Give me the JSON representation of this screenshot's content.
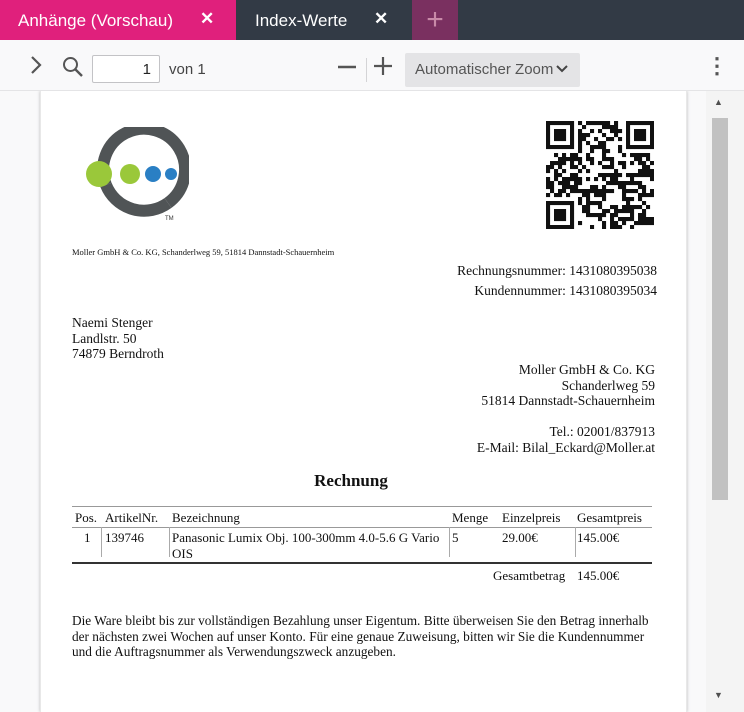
{
  "tabs": [
    {
      "label": "Anhänge (Vorschau)",
      "close": "✕"
    },
    {
      "label": "Index-Werte",
      "close": "✕"
    }
  ],
  "tab_add": "+",
  "toolbar": {
    "page_value": "1",
    "of_pages": "von 1",
    "zoom_minus": "—",
    "zoom_plus": "+",
    "zoom_label": "Automatischer Zoom",
    "menu_icon": "⋮"
  },
  "document": {
    "sender_line": "Moller GmbH & Co. KG, Schanderlweg 59, 51814 Dannstadt-Schauernheim",
    "invoice_number": "Rechnungsnummer: 1431080395038",
    "customer_number": "Kundennummer: 1431080395034",
    "recipient": [
      "Naemi Stenger",
      "Landlstr. 50",
      "74879 Berndroth"
    ],
    "company": [
      "Moller GmbH & Co. KG",
      "Schanderlweg 59",
      "51814 Dannstadt-Schauernheim"
    ],
    "contact": [
      "Tel.: 02001/837913",
      "E-Mail: Bilal_Eckard@Moller.at"
    ],
    "title": "Rechnung",
    "table": {
      "headers": [
        "Pos.",
        "ArtikelNr.",
        "Bezeichnung",
        "Menge",
        "Einzelpreis",
        "Gesamtpreis"
      ],
      "rows": [
        [
          "1",
          "139746",
          "Panasonic Lumix Obj. 100-300mm 4.0-5.6 G Vario OIS",
          "5",
          "29.00€",
          "145.00€"
        ]
      ],
      "total_label": "Gesamtbetrag",
      "total_value": "145.00€"
    },
    "footer": "Die Ware bleibt bis zur vollständigen Bezahlung unser Eigentum. Bitte überweisen Sie den Betrag innerhalb der nächsten zwei Wochen auf unser Konto. Für eine genaue Zuweisung, bitten wir Sie die Kundennummer und die Auftragsnummer als Verwendungszweck anzugeben."
  },
  "colors": {
    "tab_active": "#e0207c",
    "tab_bar": "#323a45",
    "logo_ring": "#505456",
    "logo_green": "#9ac83a",
    "logo_blue": "#2a7fc4"
  }
}
